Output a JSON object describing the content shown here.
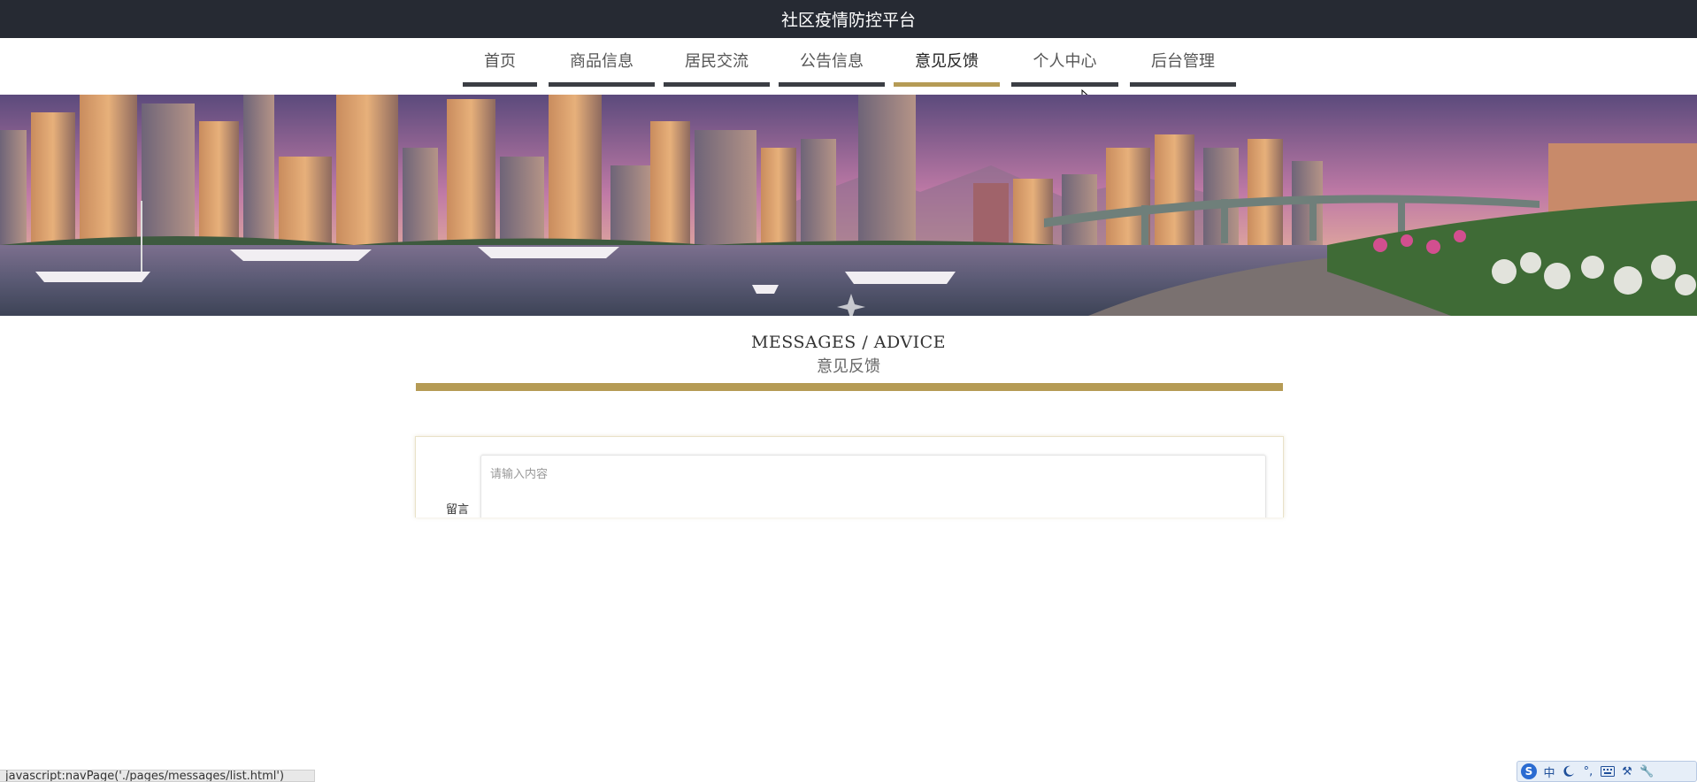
{
  "header": {
    "title": "社区疫情防控平台"
  },
  "nav": {
    "items": [
      {
        "label": "首页"
      },
      {
        "label": "商品信息"
      },
      {
        "label": "居民交流"
      },
      {
        "label": "公告信息"
      },
      {
        "label": "意见反馈",
        "active": true
      },
      {
        "label": "个人中心"
      },
      {
        "label": "后台管理"
      }
    ],
    "accent_color": "#b59b55",
    "inactive_underline_color": "#3b3e44"
  },
  "banner": {
    "image_semantic": "city-skyline-harbor-sunset"
  },
  "section": {
    "title_en": "MESSAGES / ADVICE",
    "title_zh": "意见反馈"
  },
  "form": {
    "message_label": "留言",
    "message_placeholder": "请输入内容",
    "message_value": ""
  },
  "statusbar": {
    "url": "javascript:navPage('./pages/messages/list.html')"
  },
  "ime": {
    "mode_label": "中",
    "icons": [
      "sogou-q-icon",
      "moon-icon",
      "punctuation-icon",
      "keyboard-icon",
      "tools-icon",
      "wrench-icon"
    ]
  }
}
